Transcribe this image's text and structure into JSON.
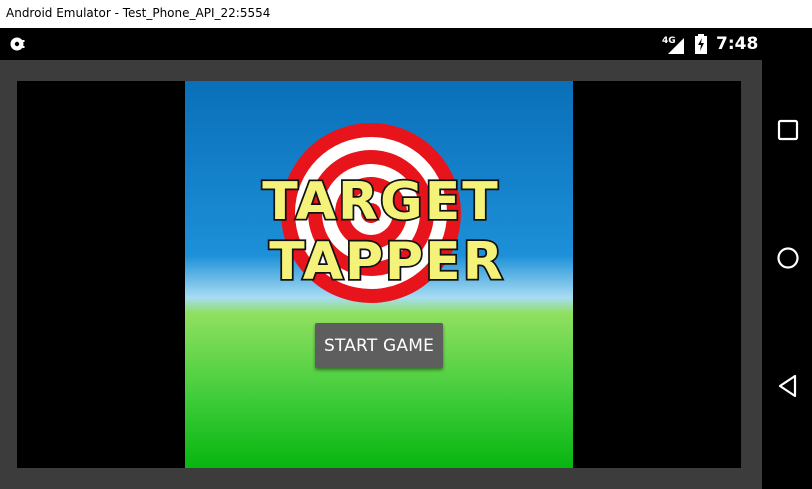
{
  "window": {
    "title": "Android Emulator - Test_Phone_API_22:5554"
  },
  "status_bar": {
    "network": "4G",
    "time": "7:48"
  },
  "game": {
    "logo_line1": "TARGET",
    "logo_line2": "TAPPER",
    "start_button_label": "START GAME"
  },
  "nav_bar": {
    "buttons": [
      "recents-button",
      "home-button",
      "back-button"
    ]
  },
  "colors": {
    "target_red": "#e8141b",
    "logo_yellow": "#f5f27a",
    "button_gray": "#5e5e5e"
  }
}
